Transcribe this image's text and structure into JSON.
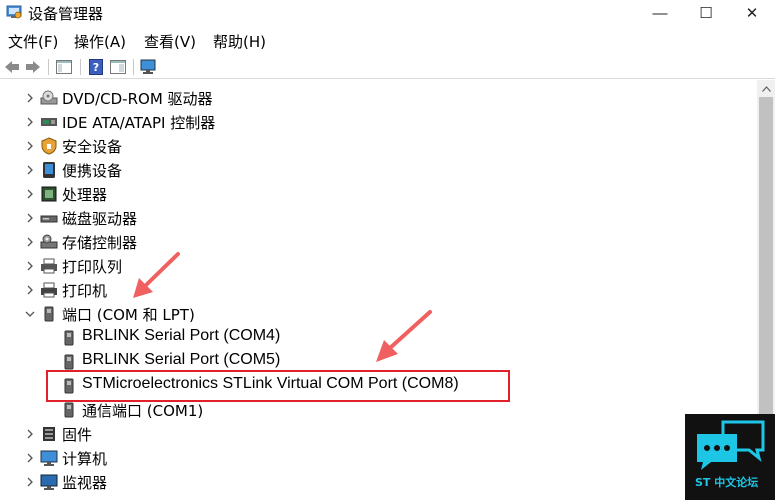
{
  "window": {
    "title": "设备管理器",
    "min_glyph": "—",
    "max_glyph": "☐",
    "close_glyph": "✕"
  },
  "menu": [
    {
      "label": "文件(F)"
    },
    {
      "label": "操作(A)"
    },
    {
      "label": "查看(V)"
    },
    {
      "label": "帮助(H)"
    }
  ],
  "toolbar": {
    "icons": [
      "back-arrow-icon",
      "forward-arrow-icon",
      "properties-icon",
      "help-icon",
      "show-hide-console-tree-icon",
      "monitor-icon"
    ]
  },
  "tree": {
    "items": [
      {
        "label": "DVD/CD-ROM 驱动器",
        "icon": "dvd-drive-icon",
        "expanded": false
      },
      {
        "label": "IDE ATA/ATAPI 控制器",
        "icon": "ide-controller-icon",
        "expanded": false
      },
      {
        "label": "安全设备",
        "icon": "security-device-icon",
        "expanded": false
      },
      {
        "label": "便携设备",
        "icon": "portable-device-icon",
        "expanded": false
      },
      {
        "label": "处理器",
        "icon": "processor-icon",
        "expanded": false
      },
      {
        "label": "磁盘驱动器",
        "icon": "disk-drive-icon",
        "expanded": false
      },
      {
        "label": "存储控制器",
        "icon": "storage-controller-icon",
        "expanded": false
      },
      {
        "label": "打印队列",
        "icon": "print-queue-icon",
        "expanded": false
      },
      {
        "label": "打印机",
        "icon": "printer-icon",
        "expanded": false
      },
      {
        "label": "端口 (COM 和 LPT)",
        "icon": "port-icon",
        "expanded": true
      },
      {
        "label": "BRLINK Serial Port (COM4)",
        "icon": "port-icon",
        "child": true
      },
      {
        "label": "BRLINK Serial Port (COM5)",
        "icon": "port-icon",
        "child": true
      },
      {
        "label": "STMicroelectronics STLink Virtual COM Port (COM8)",
        "icon": "port-icon",
        "child": true
      },
      {
        "label": "通信端口 (COM1)",
        "icon": "port-icon",
        "child": true
      },
      {
        "label": "固件",
        "icon": "firmware-icon",
        "expanded": false
      },
      {
        "label": "计算机",
        "icon": "computer-icon",
        "expanded": false
      },
      {
        "label": "监视器",
        "icon": "monitor-icon",
        "expanded": false
      }
    ]
  },
  "watermark": {
    "text": "ST 中文论坛"
  },
  "colors": {
    "highlight": "#e0202a",
    "arrow": "#f06060",
    "watermark_accent": "#1ec6e6"
  }
}
